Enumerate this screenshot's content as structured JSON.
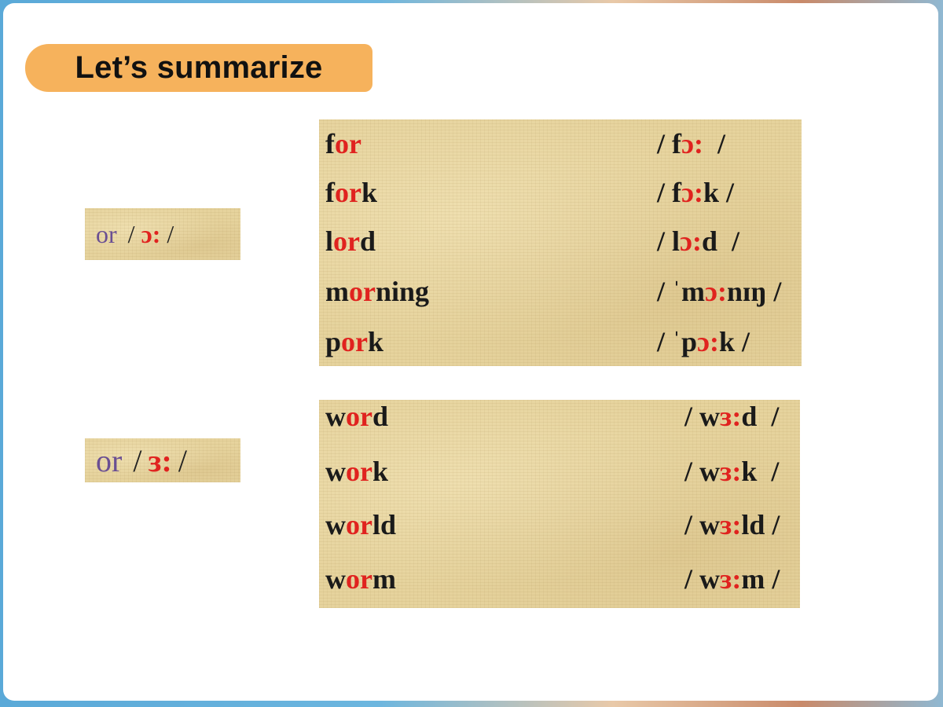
{
  "title": "Let’s summarize",
  "groups": [
    {
      "symbol": {
        "letters": "or",
        "open": "/",
        "phoneme": "ɔ:",
        "close": "/"
      },
      "words": [
        {
          "pre": "f",
          "hl": "or",
          "post": "",
          "ipa_pre": "/ f",
          "ipa_hl": "ɔ:",
          "ipa_post": "  /"
        },
        {
          "pre": "f",
          "hl": "or",
          "post": "k",
          "ipa_pre": "/ f",
          "ipa_hl": "ɔ:",
          "ipa_post": "k /"
        },
        {
          "pre": "l",
          "hl": "or",
          "post": "d",
          "ipa_pre": "/ l",
          "ipa_hl": "ɔ:",
          "ipa_post": "d  /"
        },
        {
          "pre": "m",
          "hl": "or",
          "post": "ning",
          "ipa_pre": "/ ˈm",
          "ipa_hl": "ɔ:",
          "ipa_post": "nɪŋ /"
        },
        {
          "pre": "p",
          "hl": "or",
          "post": "k",
          "ipa_pre": "/ ˈp",
          "ipa_hl": "ɔ:",
          "ipa_post": "k /"
        }
      ]
    },
    {
      "symbol": {
        "letters": "or",
        "open": "/",
        "phoneme": "ɜ:",
        "close": "/"
      },
      "words": [
        {
          "pre": "w",
          "hl": "or",
          "post": "d",
          "ipa_pre": "/ w",
          "ipa_hl": "ɜ:",
          "ipa_post": "d  /"
        },
        {
          "pre": "w",
          "hl": "or",
          "post": "k",
          "ipa_pre": "/ w",
          "ipa_hl": "ɜ:",
          "ipa_post": "k  /"
        },
        {
          "pre": "w",
          "hl": "or",
          "post": "ld",
          "ipa_pre": "/ w",
          "ipa_hl": "ɜ:",
          "ipa_post": "ld /"
        },
        {
          "pre": "w",
          "hl": "or",
          "post": "m",
          "ipa_pre": "/ w",
          "ipa_hl": "ɜ:",
          "ipa_post": "m /"
        }
      ]
    }
  ]
}
